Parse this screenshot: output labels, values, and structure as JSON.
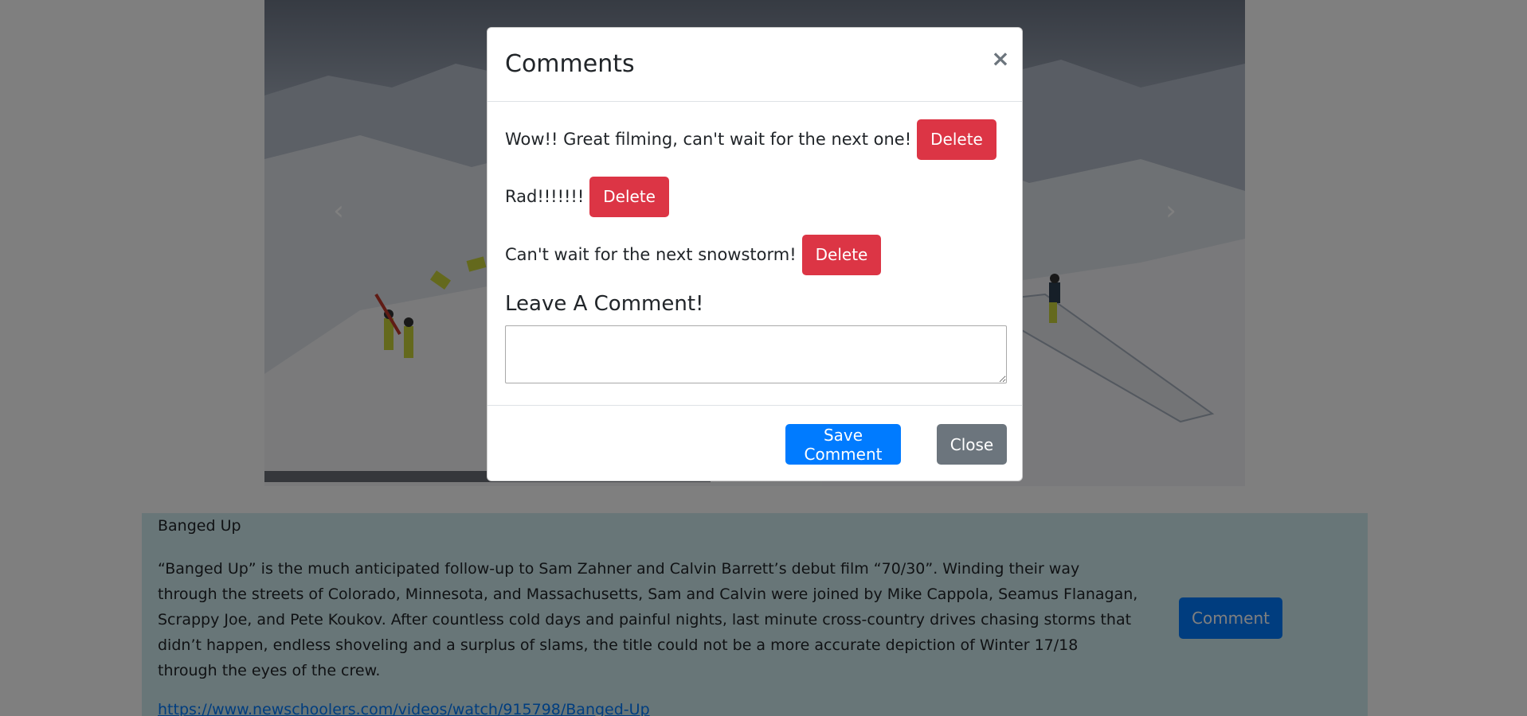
{
  "carousel": {
    "prev_icon": "chevron-left-icon",
    "next_icon": "chevron-right-icon",
    "prev_glyph": "‹",
    "next_glyph": "›"
  },
  "post": {
    "title": "Banged Up",
    "description": "“Banged Up” is the much anticipated follow-up to Sam Zahner and Calvin Barrett’s debut film “70/30”. Winding their way through the streets of Colorado, Minnesota, and Massachusetts, Sam and Calvin were joined by Mike Cappola, Seamus Flanagan, Scrappy Joe, and Pete Koukov. After countless cold days and painful nights, last minute cross-country drives chasing storms that didn’t happen, endless shoveling and a surplus of slams, the title could not be a more accurate depiction of Winter 17/18 through the eyes of the crew.",
    "link": "https://www.newschoolers.com/videos/watch/915798/Banged-Up",
    "comment_label": "Comment"
  },
  "modal": {
    "title": "Comments",
    "close_glyph": "×",
    "comments": [
      {
        "text": "Wow!! Great filming, can't wait for the next one!",
        "delete_label": "Delete"
      },
      {
        "text": "Rad!!!!!!!",
        "delete_label": "Delete"
      },
      {
        "text": "Can't wait for the next snowstorm!",
        "delete_label": "Delete"
      }
    ],
    "leave_label": "Leave A Comment!",
    "input_value": "",
    "input_placeholder": "",
    "save_label": "Save Comment",
    "close_label": "Close"
  },
  "colors": {
    "primary": "#007bff",
    "danger": "#dc3545",
    "secondary": "#6c757d",
    "info_bg": "#d1ecf1"
  }
}
